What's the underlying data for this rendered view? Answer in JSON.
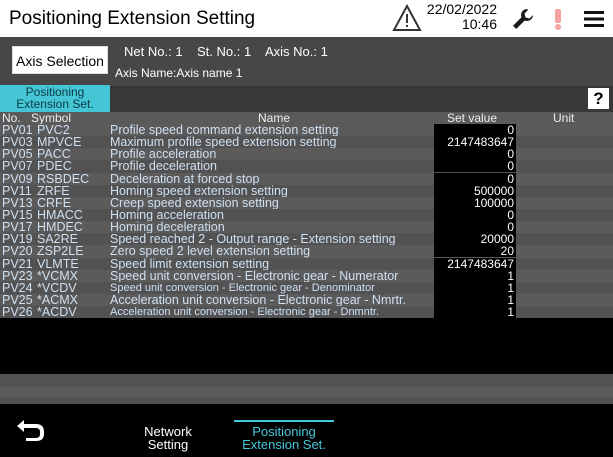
{
  "header": {
    "title": "Positioning Extension Setting",
    "date": "22/02/2022",
    "time": "10:46"
  },
  "info": {
    "axis_selection_label": "Axis Selection",
    "net_no_label": "Net No.:",
    "net_no": "1",
    "st_no_label": "St. No.:",
    "st_no": "1",
    "axis_no_label": "Axis No.:",
    "axis_no": "1",
    "axis_name_label": "Axis Name:",
    "axis_name": "Axis name 1"
  },
  "tabs": {
    "active_line1": "Positioning",
    "active_line2": "Extension Set.",
    "help_label": "?"
  },
  "table": {
    "headers": {
      "no": "No.",
      "symbol": "Symbol",
      "name": "Name",
      "set_value": "Set value",
      "unit": "Unit"
    },
    "rows": [
      {
        "no": "PV01",
        "symbol": "PVC2",
        "name": "Profile speed command extension setting",
        "value": "0",
        "unit": ""
      },
      {
        "no": "PV03",
        "symbol": "MPVCE",
        "name": "Maximum profile speed extension setting",
        "value": "2147483647",
        "unit": ""
      },
      {
        "no": "PV05",
        "symbol": "PACC",
        "name": "Profile acceleration",
        "value": "0",
        "unit": ""
      },
      {
        "no": "PV07",
        "symbol": "PDEC",
        "name": "Profile deceleration",
        "value": "0",
        "unit": ""
      },
      {
        "no": "PV09",
        "symbol": "RSBDEC",
        "name": "Deceleration at forced stop",
        "value": "0",
        "unit": ""
      },
      {
        "no": "PV11",
        "symbol": "ZRFE",
        "name": "Homing speed extension setting",
        "value": "500000",
        "unit": ""
      },
      {
        "no": "PV13",
        "symbol": "CRFE",
        "name": "Creep speed extension setting",
        "value": "100000",
        "unit": ""
      },
      {
        "no": "PV15",
        "symbol": "HMACC",
        "name": "Homing acceleration",
        "value": "0",
        "unit": ""
      },
      {
        "no": "PV17",
        "symbol": "HMDEC",
        "name": "Homing deceleration",
        "value": "0",
        "unit": ""
      },
      {
        "no": "PV19",
        "symbol": "SA2RE",
        "name": "Speed reached 2 - Output range - Extension setting",
        "value": "20000",
        "unit": ""
      },
      {
        "no": "PV20",
        "symbol": "ZSP2LE",
        "name": "Zero speed 2 level extension setting",
        "value": "20",
        "unit": ""
      },
      {
        "no": "PV21",
        "symbol": "VLMTE",
        "name": "Speed limit extension setting",
        "value": "2147483647",
        "unit": ""
      },
      {
        "no": "PV23",
        "symbol": "*VCMX",
        "name": "Speed unit conversion - Electronic gear - Numerator",
        "value": "1",
        "unit": ""
      },
      {
        "no": "PV24",
        "symbol": "*VCDV",
        "name": "Speed unit conversion - Electronic gear - Denominator",
        "value": "1",
        "unit": ""
      },
      {
        "no": "PV25",
        "symbol": "*ACMX",
        "name": "Acceleration unit conversion - Electronic gear - Nmrtr.",
        "value": "1",
        "unit": ""
      },
      {
        "no": "PV26",
        "symbol": "*ACDV",
        "name": "Acceleration unit conversion - Electronic gear - Dnmntr.",
        "value": "1",
        "unit": ""
      }
    ]
  },
  "footer": {
    "network_line1": "Network",
    "network_line2": "Setting",
    "positioning_line1": "Positioning",
    "positioning_line2": "Extension Set."
  },
  "colors": {
    "accent": "#44c6d7",
    "header_bg": "#ffffff",
    "warning": "#ff9999"
  },
  "icons": [
    "warning-triangle-icon",
    "wrench-icon",
    "alert-icon",
    "menu-icon",
    "back-arrow-icon"
  ]
}
